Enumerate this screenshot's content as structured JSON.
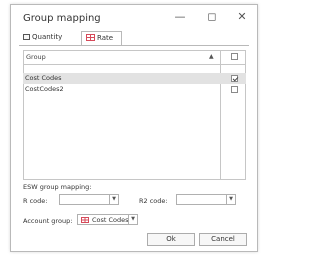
{
  "window": {
    "title": "Group mapping",
    "minimize_icon": "minimize-icon",
    "maximize_icon": "maximize-icon",
    "close_icon": "close-icon"
  },
  "tabs": [
    {
      "label": "Quantity",
      "icon": "quantity-icon"
    },
    {
      "label": "Rate",
      "icon": "rate-table-icon",
      "active": true
    }
  ],
  "grid": {
    "header": "Group",
    "rows": [
      {
        "label": "Cost Codes",
        "checked": true,
        "selected": true
      },
      {
        "label": "CostCodes2",
        "checked": false,
        "selected": false
      }
    ]
  },
  "esw": {
    "section_label": "ESW group mapping:",
    "r_code_label": "R code:",
    "r_code_value": "",
    "r2_code_label": "R2 code:",
    "r2_code_value": ""
  },
  "account_group": {
    "label": "Account group:",
    "value": "Cost Codes"
  },
  "buttons": {
    "ok": "Ok",
    "cancel": "Cancel"
  },
  "colors": {
    "accent_icon": "#d64a5a",
    "selected_row": "#e2e2e2"
  }
}
